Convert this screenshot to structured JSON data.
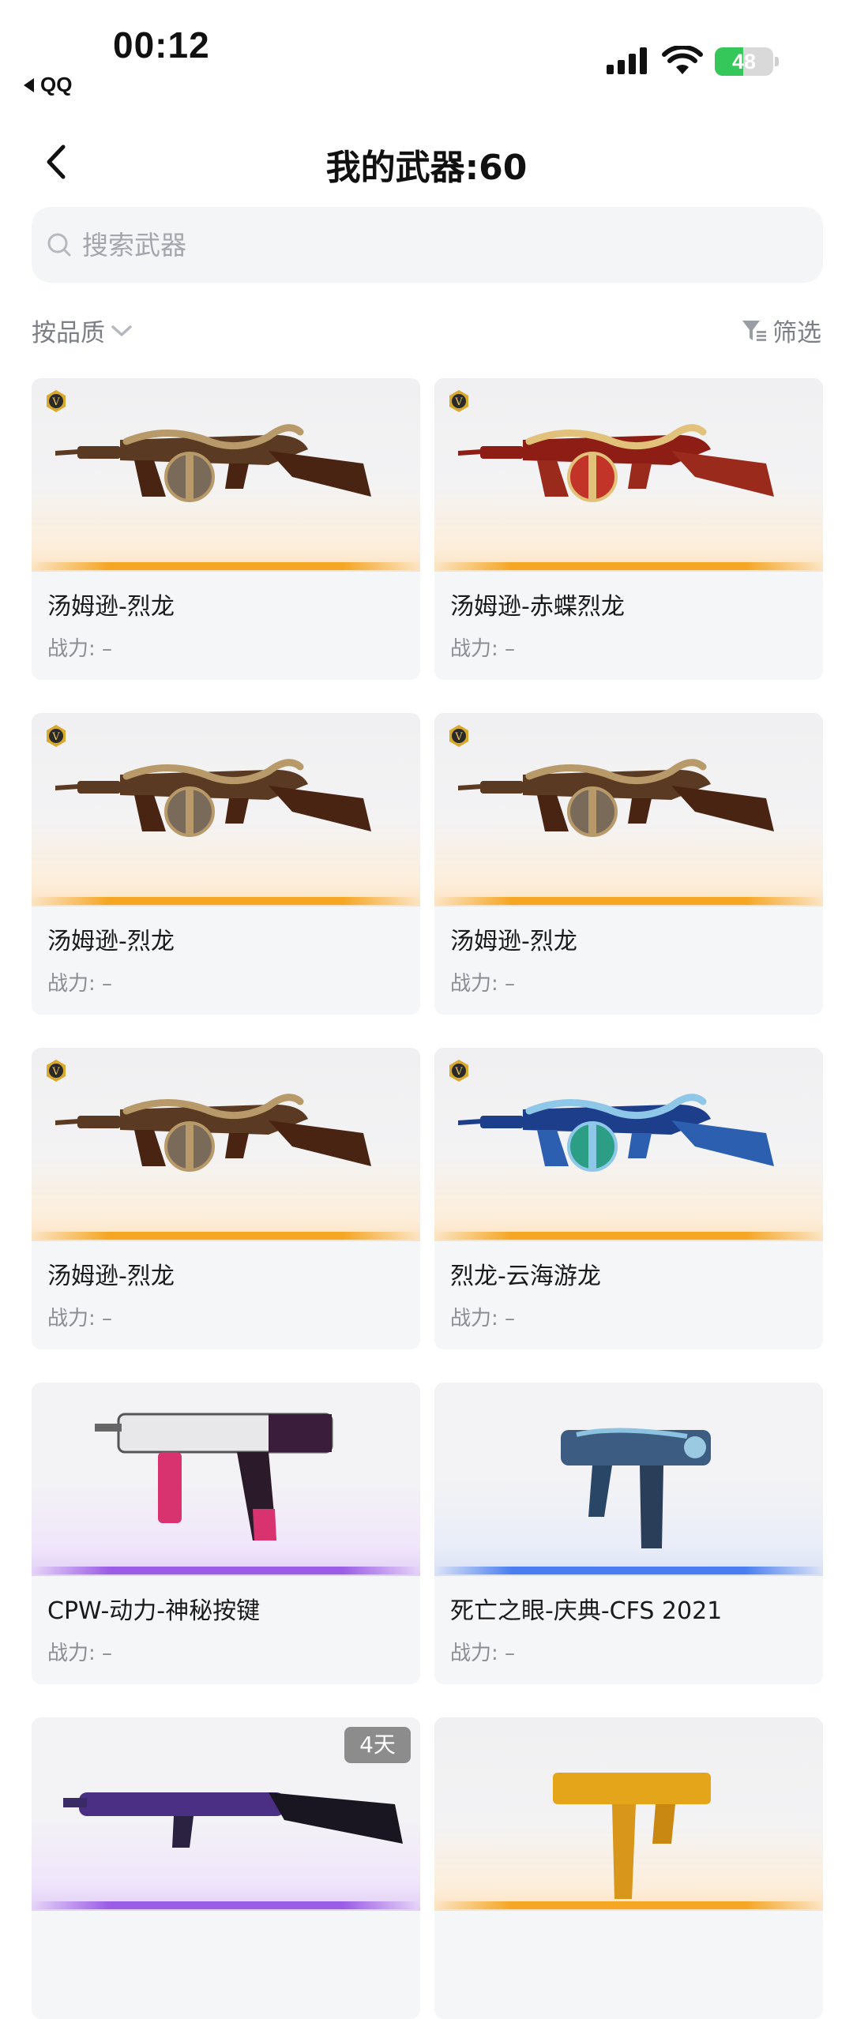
{
  "status_bar": {
    "time": "00:12",
    "back_app": "QQ",
    "battery_level": 48,
    "battery_text": "48",
    "battery_color": "#35c759",
    "icons": [
      "cellular-signal-icon",
      "wifi-icon",
      "battery-charging-icon"
    ]
  },
  "header": {
    "title": "我的武器:60",
    "back_icon": "chevron-left-icon"
  },
  "search": {
    "placeholder": "搜索武器",
    "value": "",
    "icon": "search-icon"
  },
  "toolbar": {
    "sort_label": "按品质",
    "sort_icon": "chevron-down-icon",
    "filter_label": "筛选",
    "filter_icon": "filter-icon"
  },
  "colors": {
    "gold": "#f5a623",
    "purple": "#9b5de5",
    "blue": "#4a7ef0"
  },
  "weapons": [
    {
      "name": "汤姆逊-烈龙",
      "power": "战力: –",
      "quality": "gold",
      "badge": "V",
      "art": "tommy-dragon-bronze"
    },
    {
      "name": "汤姆逊-赤蝶烈龙",
      "power": "战力: –",
      "quality": "gold",
      "badge": "V",
      "art": "tommy-dragon-red"
    },
    {
      "name": "汤姆逊-烈龙",
      "power": "战力: –",
      "quality": "gold",
      "badge": "V",
      "art": "tommy-dragon-bronze"
    },
    {
      "name": "汤姆逊-烈龙",
      "power": "战力: –",
      "quality": "gold",
      "badge": "V",
      "art": "tommy-dragon-bronze"
    },
    {
      "name": "汤姆逊-烈龙",
      "power": "战力: –",
      "quality": "gold",
      "badge": "V",
      "art": "tommy-dragon-bronze"
    },
    {
      "name": "烈龙-云海游龙",
      "power": "战力: –",
      "quality": "gold",
      "badge": "V",
      "art": "tommy-dragon-blue"
    },
    {
      "name": "CPW-动力-神秘按键",
      "power": "战力: –",
      "quality": "purple",
      "badge": "",
      "art": "smg-pink"
    },
    {
      "name": "死亡之眼-庆典-CFS 2021",
      "power": "战力: –",
      "quality": "blue",
      "badge": "",
      "art": "pistol-blue"
    },
    {
      "name": "",
      "power": "",
      "quality": "purple",
      "badge": "",
      "art": "rifle-purple",
      "days_left": "4天"
    },
    {
      "name": "",
      "power": "",
      "quality": "gold",
      "badge": "",
      "art": "uzi-gold"
    }
  ]
}
